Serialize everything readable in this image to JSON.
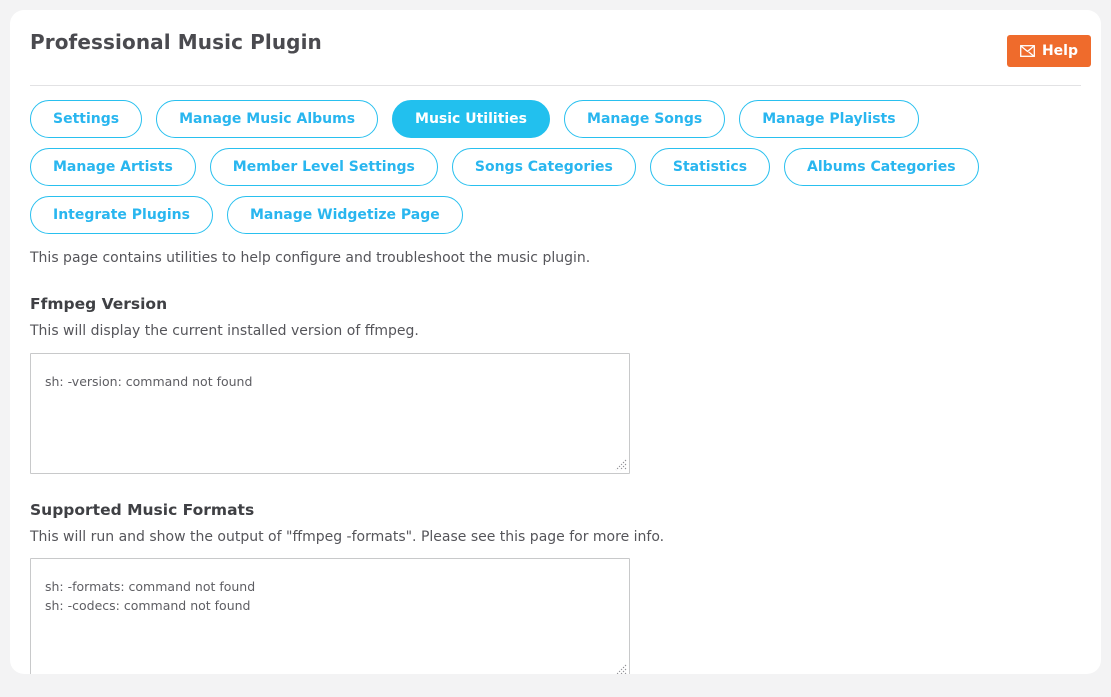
{
  "header": {
    "title": "Professional Music Plugin",
    "help_label": "Help",
    "help_icon": "envelope-icon",
    "help_color": "#ef6b2c"
  },
  "theme": {
    "accent": "#22c0ee",
    "accent_border": "#29c0ef",
    "page_background": "#f3f3f4",
    "card_background": "#ffffff",
    "text": "#55555a"
  },
  "tabs": [
    {
      "label": "Settings",
      "active": false
    },
    {
      "label": "Manage Music Albums",
      "active": false
    },
    {
      "label": "Music Utilities",
      "active": true
    },
    {
      "label": "Manage Songs",
      "active": false
    },
    {
      "label": "Manage Playlists",
      "active": false
    },
    {
      "label": "Manage Artists",
      "active": false
    },
    {
      "label": "Member Level Settings",
      "active": false
    },
    {
      "label": "Songs Categories",
      "active": false
    },
    {
      "label": "Statistics",
      "active": false
    },
    {
      "label": "Albums Categories",
      "active": false
    },
    {
      "label": "Integrate Plugins",
      "active": false
    },
    {
      "label": "Manage Widgetize Page",
      "active": false
    }
  ],
  "main": {
    "intro": "This page contains utilities to help configure and troubleshoot the music plugin.",
    "sections": [
      {
        "heading": "Ffmpeg Version",
        "description": "This will display the current installed version of ffmpeg.",
        "output": "sh: -version: command not found"
      },
      {
        "heading": "Supported Music Formats",
        "description": "This will run and show the output of \"ffmpeg -formats\". Please see this page for more info.",
        "output": "sh: -formats: command not found\nsh: -codecs: command not found"
      }
    ]
  }
}
